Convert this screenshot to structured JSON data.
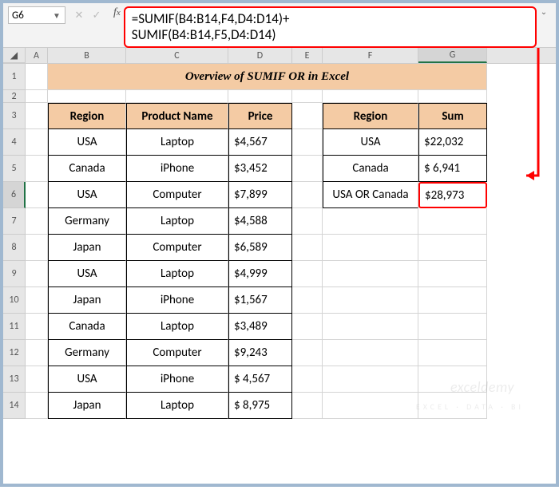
{
  "nameBox": "G6",
  "formula_line1": "=SUMIF(B4:B14,F4,D4:D14)+",
  "formula_line2": "SUMIF(B4:B14,F5,D4:D14)",
  "title": "Overview of SUMIF OR in Excel",
  "cols": {
    "A": "A",
    "B": "B",
    "C": "C",
    "D": "D",
    "E": "E",
    "F": "F",
    "G": "G"
  },
  "rows": [
    "1",
    "2",
    "3",
    "4",
    "5",
    "6",
    "7",
    "8",
    "9",
    "10",
    "11",
    "12",
    "13",
    "14"
  ],
  "tbl1": {
    "h1": "Region",
    "h2": "Product Name",
    "h3": "Price",
    "r": [
      {
        "region": "USA",
        "prod": "Laptop",
        "price": "$4,567"
      },
      {
        "region": "Canada",
        "prod": "iPhone",
        "price": "$3,452"
      },
      {
        "region": "USA",
        "prod": "Computer",
        "price": "$7,899"
      },
      {
        "region": "Germany",
        "prod": "Laptop",
        "price": "$4,588"
      },
      {
        "region": "Japan",
        "prod": "Computer",
        "price": "$6,589"
      },
      {
        "region": "USA",
        "prod": "Laptop",
        "price": "$4,999"
      },
      {
        "region": "Japan",
        "prod": "iPhone",
        "price": "$1,567"
      },
      {
        "region": "Canada",
        "prod": "Laptop",
        "price": "$3,489"
      },
      {
        "region": "Germany",
        "prod": "Computer",
        "price": "$9,243"
      },
      {
        "region": "USA",
        "prod": "iPhone",
        "price": "$  4,567"
      },
      {
        "region": "Japan",
        "prod": "Laptop",
        "price": "$  8,975"
      }
    ]
  },
  "tbl2": {
    "h1": "Region",
    "h2": "Sum",
    "r": [
      {
        "region": "USA",
        "sum": "$22,032"
      },
      {
        "region": "Canada",
        "sum": "$  6,941"
      },
      {
        "region": "USA OR Canada",
        "sum": "$28,973"
      }
    ]
  },
  "chart_data": {
    "type": "table",
    "source_table": [
      [
        "Region",
        "Product Name",
        "Price"
      ],
      [
        "USA",
        "Laptop",
        4567
      ],
      [
        "Canada",
        "iPhone",
        3452
      ],
      [
        "USA",
        "Computer",
        7899
      ],
      [
        "Germany",
        "Laptop",
        4588
      ],
      [
        "Japan",
        "Computer",
        6589
      ],
      [
        "USA",
        "Laptop",
        4999
      ],
      [
        "Japan",
        "iPhone",
        1567
      ],
      [
        "Canada",
        "Laptop",
        3489
      ],
      [
        "Germany",
        "Computer",
        9243
      ],
      [
        "USA",
        "iPhone",
        4567
      ],
      [
        "Japan",
        "Laptop",
        8975
      ]
    ],
    "summary_table": [
      [
        "Region",
        "Sum"
      ],
      [
        "USA",
        22032
      ],
      [
        "Canada",
        6941
      ],
      [
        "USA OR Canada",
        28973
      ]
    ],
    "formula": "=SUMIF(B4:B14,F4,D4:D14)+SUMIF(B4:B14,F5,D4:D14)",
    "selected_cell": "G6"
  }
}
